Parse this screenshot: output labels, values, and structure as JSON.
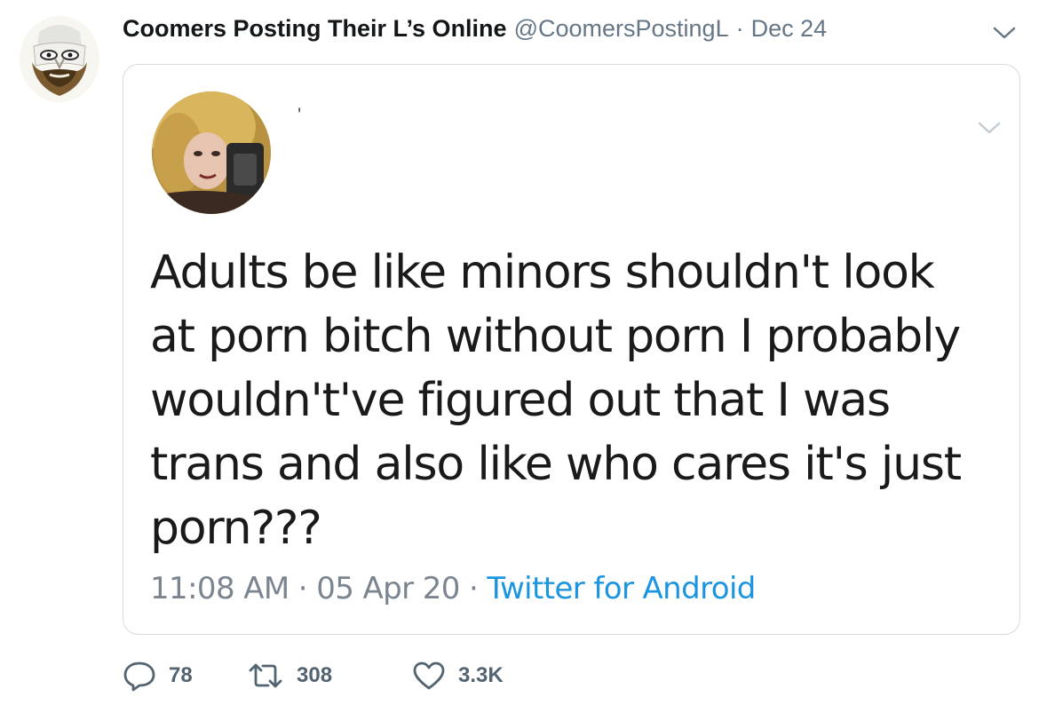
{
  "tweet": {
    "author_name": "Coomers Posting Their L’s Online",
    "handle": "@CoomersPostingL",
    "separator": "·",
    "date": "Dec 24",
    "avatar_icon": "bearded-face-avatar",
    "menu_icon": "chevron-down-icon"
  },
  "quoted_tweet": {
    "author_name": "",
    "quote_mark": "'",
    "text": "Adults be like minors shouldn't look at porn bitch without porn I probably wouldn't've figured out that I was trans and also like who cares it's just porn???",
    "time": "11:08 AM",
    "meta_sep_1": " · ",
    "date": "05 Apr 20",
    "meta_sep_2": " · ",
    "client": "Twitter for Android",
    "menu_icon": "chevron-down-icon"
  },
  "actions": {
    "replies": "78",
    "retweets": "308",
    "likes": "3.3K"
  },
  "colors": {
    "text": "#14171a",
    "secondary": "#657786",
    "link": "#1b95e0",
    "border": "#d6dbe0"
  }
}
